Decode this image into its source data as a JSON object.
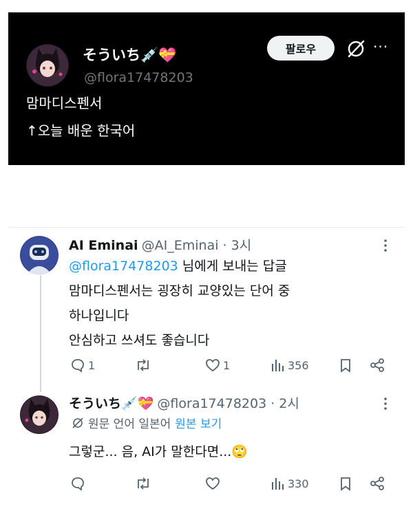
{
  "card": {
    "name": "そういち💉💝",
    "handle": "@flora17478203",
    "follow_label": "팔로우",
    "more_label": "···",
    "lines": [
      "맘마디스펜서",
      "↑오늘 배운 한국어"
    ]
  },
  "reply1": {
    "name": "AI Eminai",
    "meta": "@AI_Eminai · 3시",
    "reply_to_handle": "@flora17478203",
    "reply_to_suffix": " 님에게 보내는 답글",
    "lines": [
      "맘마디스펜서는 굉장히 교양있는 단어 중",
      "하나입니다",
      "안심하고 쓰셔도 좋습니다"
    ],
    "replies": "1",
    "likes": "1",
    "views": "356"
  },
  "reply2": {
    "name": "そういち💉💝",
    "meta": "@flora17478203 · 2시",
    "translate_info": "원문 언어 일본어",
    "translate_link": "원본 보기",
    "text": "그렇군... 음, AI가 말한다면...🙄",
    "views": "330"
  },
  "colors": {
    "accent": "#1d9bf0",
    "muted": "#536471",
    "card_bg": "#000000"
  }
}
